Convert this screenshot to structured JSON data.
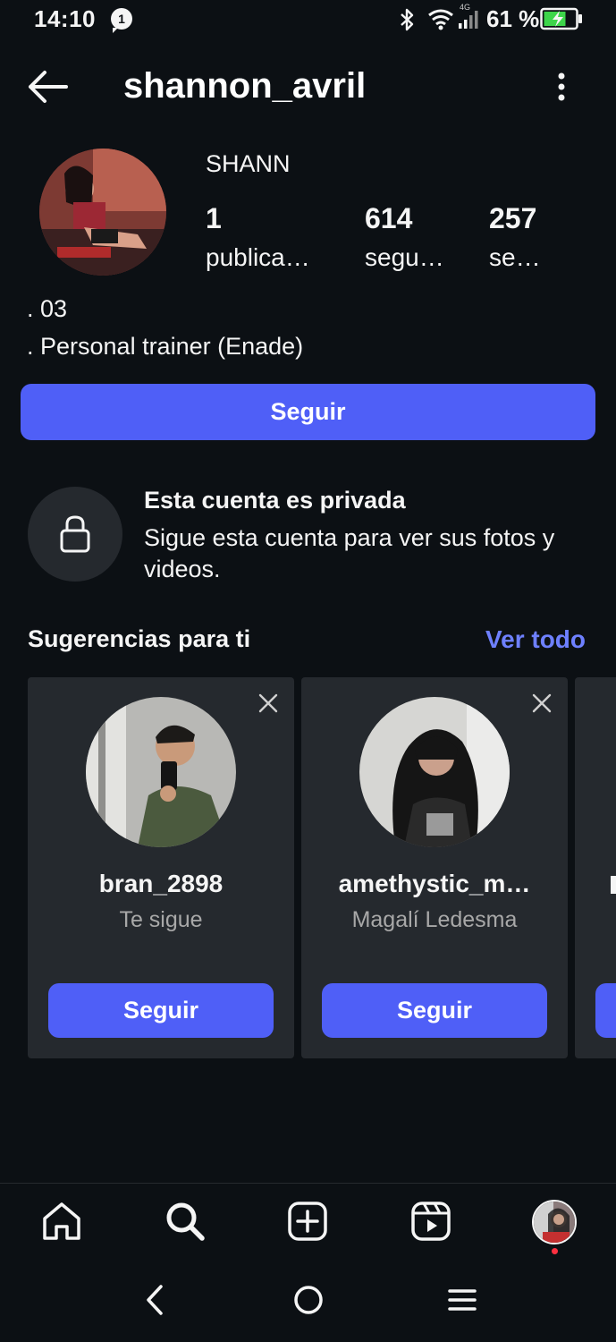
{
  "status_bar": {
    "time": "14:10",
    "notification_count": "1",
    "network_type": "4G",
    "battery_percent": "61 %"
  },
  "header": {
    "username": "shannon_avril",
    "back_icon": "arrow-left-icon",
    "menu_icon": "more-vertical-icon"
  },
  "profile": {
    "display_name": "SHANN",
    "stats": [
      {
        "value": "1",
        "label": "publica…"
      },
      {
        "value": "614",
        "label": "segu…"
      },
      {
        "value": "257",
        "label": "se…"
      }
    ],
    "bio": [
      ". 03",
      ". Personal trainer (Enade)"
    ],
    "follow_label": "Seguir"
  },
  "private_notice": {
    "title": "Esta cuenta es privada",
    "description": "Sigue esta cuenta para ver sus fotos y videos."
  },
  "suggestions": {
    "title": "Sugerencias para ti",
    "see_all": "Ver todo",
    "cards": [
      {
        "username": "bran_2898",
        "subtitle": "Te sigue",
        "button": "Seguir"
      },
      {
        "username": "amethystic_m…",
        "subtitle": "Magalí Ledesma",
        "button": "Seguir"
      }
    ]
  },
  "tab_bar": [
    "home-icon",
    "search-icon",
    "create-icon",
    "reels-icon",
    "profile-avatar"
  ],
  "system_nav": [
    "back-icon",
    "home-circle-icon",
    "recents-icon"
  ],
  "colors": {
    "background": "#0c1014",
    "accent": "#4f5ff7",
    "link": "#6e80ff",
    "card": "#25292e",
    "secondary_text": "#a8a8a8"
  }
}
